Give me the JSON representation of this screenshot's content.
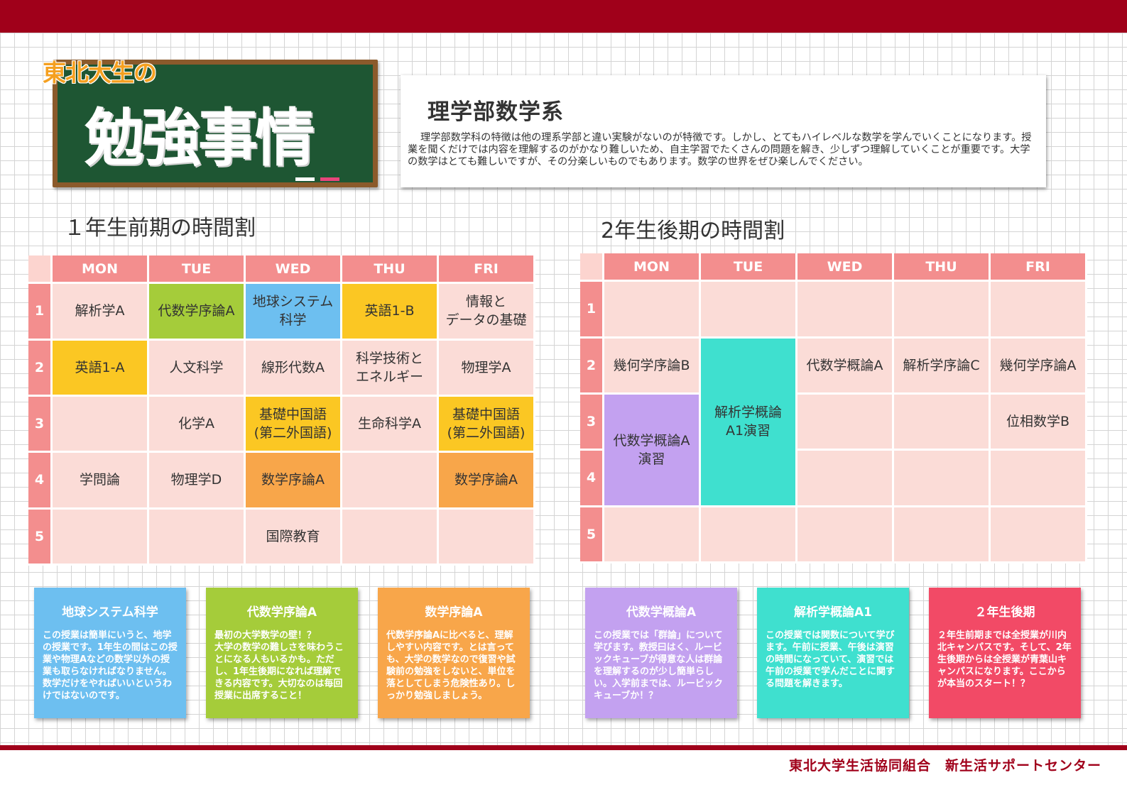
{
  "header": {
    "board_subtitle": "東北大生の",
    "board_title": "勉強事情"
  },
  "intro": {
    "heading": "理学部数学系",
    "body": "理学部数学科の特徴は他の理系学部と違い実験がないのが特徴です。しかし、とてもハイレベルな数学を学んでいくことになります。授業を聞くだけでは内容を理解するのがかなり難しいため、自主学習でたくさんの問題を解き、少しずつ理解していくことが重要です。大学の数学はとても難しいですが、その分楽しいものでもあります。数学の世界をぜひ楽しんでください。"
  },
  "table1": {
    "title": "１年生前期の時間割",
    "days": [
      "MON",
      "TUE",
      "WED",
      "THU",
      "FRI"
    ],
    "periods": [
      "1",
      "2",
      "3",
      "4",
      "5"
    ],
    "rows": [
      [
        "解析学A",
        "代数学序論A",
        "地球システム\n科学",
        "英語1-B",
        "情報と\nデータの基礎"
      ],
      [
        "英語1-A",
        "人文科学",
        "線形代数A",
        "科学技術と\nエネルギー",
        "物理学A"
      ],
      [
        "",
        "化学A",
        "基礎中国語\n(第二外国語)",
        "生命科学A",
        "基礎中国語\n(第二外国語)"
      ],
      [
        "学問論",
        "物理学D",
        "数学序論A",
        "",
        "数学序論A"
      ],
      [
        "",
        "",
        "国際教育",
        "",
        ""
      ]
    ]
  },
  "table2": {
    "title": "2年生後期の時間割",
    "days": [
      "MON",
      "TUE",
      "WED",
      "THU",
      "FRI"
    ],
    "periods": [
      "1",
      "2",
      "3",
      "4",
      "5"
    ],
    "mon2": "幾何学序論B",
    "tue_merged": "解析学概論\nA1演習",
    "wed2": "代数学概論A",
    "thu2": "解析学序論C",
    "fri2": "幾何学序論A",
    "mon_merged": "代数学概論A\n演習",
    "fri3": "位相数学B"
  },
  "cards": [
    {
      "title": "地球システム科学",
      "body": "この授業は簡単にいうと、地学の授業です。1年生の間はこの授業や物理Aなどの数学以外の授業も取らなければなりません。数学だけをやればいいというわけではないのです。",
      "color": "#6dbff0"
    },
    {
      "title": "代数学序論A",
      "body": "最初の大学数学の壁！？\n大学の数学の難しさを味わうことになる人もいるかも。ただし、1年生後期になれば理解できる内容です。大切なのは毎回授業に出席すること！",
      "color": "#a5cc3a"
    },
    {
      "title": "数学序論A",
      "body": "代数学序論Aに比べると、理解しやすい内容です。とは言っても、大学の数学なので復習や試験前の勉強をしないと、単位を落としてしまう危険性あり。しっかり勉強しましょう。",
      "color": "#f8a64a"
    },
    {
      "title": "代数学概論A",
      "body": "この授業では「群論」について学びます。教授曰はく、ルービックキューブが得意な人は群論を理解するのが少し簡単らしい。入学前までは、ルービックキューブか！？",
      "color": "#c3a1f0"
    },
    {
      "title": "解析学概論A1",
      "body": "この授業では関数について学びます。午前に授業、午後は演習の時間になっていて、演習では午前の授業で学んだことに関する問題を解きます。",
      "color": "#3fe0cf"
    },
    {
      "title": "２年生後期",
      "body": "２年生前期までは全授業が川内北キャンパスです。そして、2年生後期からは全授業が青葉山キャンパスになります。ここからが本当のスタート！？",
      "color": "#f24a66"
    }
  ],
  "footer": {
    "text": "東北大学生活協同組合　新生活サポートセンター"
  }
}
